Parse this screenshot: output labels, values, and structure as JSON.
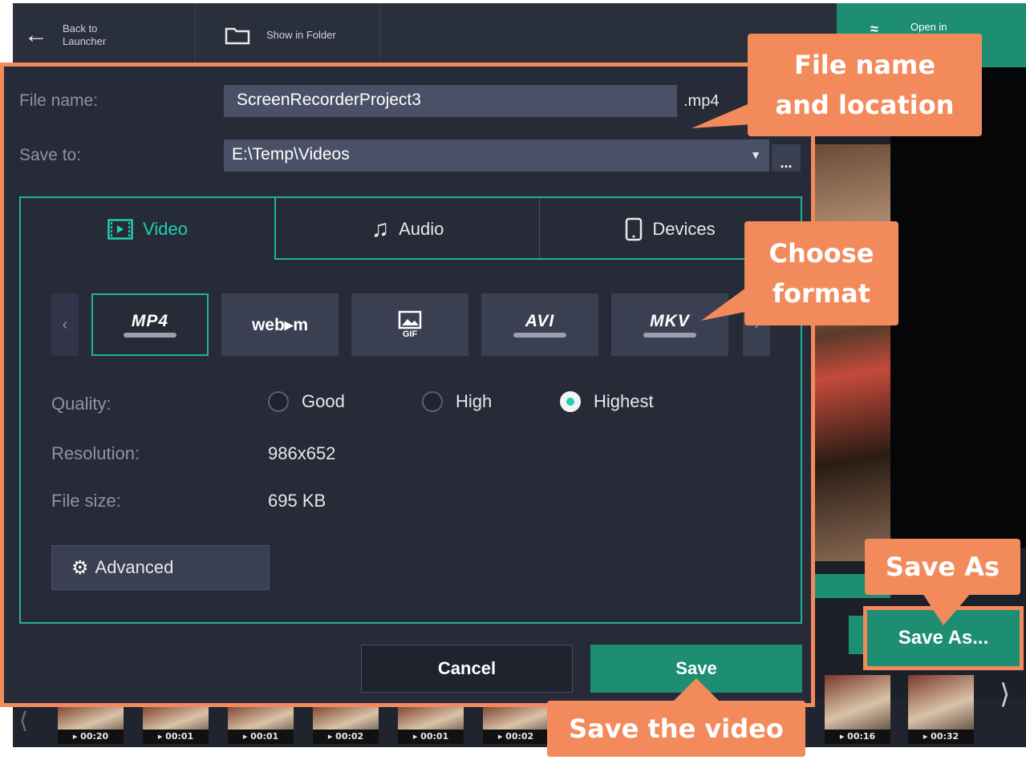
{
  "topbar": {
    "back_label": "Back to Launcher",
    "show_in_folder": "Show in Folder",
    "open_in": "Open in"
  },
  "dialog": {
    "file_name_label": "File name:",
    "file_name_value": "ScreenRecorderProject3",
    "extension": ".mp4",
    "save_to_label": "Save to:",
    "save_to_value": "E:\\Temp\\Videos",
    "browse": "...",
    "tabs": [
      {
        "label": "Video",
        "active": true
      },
      {
        "label": "Audio",
        "active": false
      },
      {
        "label": "Devices",
        "active": false
      }
    ],
    "formats": [
      {
        "label": "MP4",
        "selected": true
      },
      {
        "label": "web▸m",
        "selected": false
      },
      {
        "label": "GIF",
        "selected": false
      },
      {
        "label": "AVI",
        "selected": false
      },
      {
        "label": "MKV",
        "selected": false
      }
    ],
    "quality_label": "Quality:",
    "quality_options": [
      "Good",
      "High",
      "Highest"
    ],
    "quality_selected": "Highest",
    "resolution_label": "Resolution:",
    "resolution_value": "986x652",
    "file_size_label": "File size:",
    "file_size_value": "695 KB",
    "advanced": "Advanced",
    "cancel": "Cancel",
    "save": "Save"
  },
  "save_as_button": "Save As...",
  "filmstrip": [
    "▸ 00:20",
    "▸ 00:01",
    "▸ 00:01",
    "▸ 00:02",
    "▸ 00:01",
    "▸ 00:02",
    "▸ 00:16",
    "▸ 00:32"
  ],
  "callouts": {
    "file_name_location": "File name and location",
    "choose_format": "Choose format",
    "save_as": "Save As",
    "save_video": "Save the video"
  },
  "colors": {
    "accent_teal": "#1fb39a",
    "save_green": "#1d8e72",
    "callout_orange": "#f28a5c",
    "dialog_bg": "#262b37"
  }
}
